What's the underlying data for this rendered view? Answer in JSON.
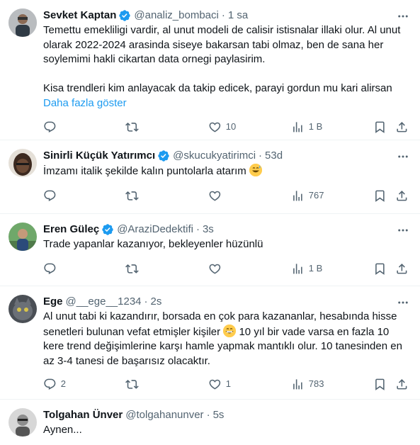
{
  "tweets": [
    {
      "name": "Sevket Kaptan",
      "handle": "@analiz_bombaci",
      "sep": "·",
      "time": "1 sa",
      "text": "Temettu emekliligi vardir, al unut modeli de calisir istisnalar illaki olur. Al unut olarak 2022-2024 arasinda siseye bakarsan tabi olmaz, ben de sana her soylemimi hakli cikartan data ornegi paylasirim.\n\nKisa trendleri kim anlayacak da takip edicek, parayi gordun mu kari alirsan",
      "show_more": "Daha fazla göster",
      "replies": "",
      "reposts": "",
      "likes": "10",
      "views": "1 B"
    },
    {
      "name": "Sinirli Küçük Yatırımcı",
      "handle": "@skucukyatirimci",
      "sep": "·",
      "time": "53d",
      "text": "İmzamı italik şekilde kalın puntolarla atarım",
      "replies": "",
      "reposts": "",
      "likes": "",
      "views": "767"
    },
    {
      "name": "Eren Güleç",
      "handle": "@AraziDedektifi",
      "sep": "·",
      "time": "3s",
      "text": "Trade yapanlar kazanıyor, bekleyenler hüzünlü",
      "replies": "",
      "reposts": "",
      "likes": "",
      "views": "1 B"
    },
    {
      "name": "Ege",
      "handle": "@__ege__1234",
      "sep": "·",
      "time": "2s",
      "text_part1": "Al unut tabi ki kazandırır, borsada en çok para kazananlar, hesabında hisse senetleri bulunan vefat etmişler kişiler ",
      "text_part2": " 10 yıl bir vade varsa en fazla 10 kere trend değişimlerine karşı hamle yapmak mantıklı olur. 10 tanesinden en az 3-4 tanesi de başarısız olacaktır.",
      "replies": "2",
      "reposts": "",
      "likes": "1",
      "views": "783"
    },
    {
      "name": "Tolgahan Ünver",
      "handle": "@tolgahanunver",
      "sep": "·",
      "time": "5s",
      "text": "Aynen..."
    }
  ],
  "colors": {
    "accent": "#1d9bf0",
    "secondary_text": "#536471",
    "primary_text": "#0f1419",
    "divider": "#eff3f4"
  },
  "icons": [
    "verified-badge-icon",
    "more-icon",
    "reply-icon",
    "repost-icon",
    "like-icon",
    "views-icon",
    "bookmark-icon",
    "share-icon",
    "grinning-sweat-emoji",
    "grinning-emoji"
  ]
}
